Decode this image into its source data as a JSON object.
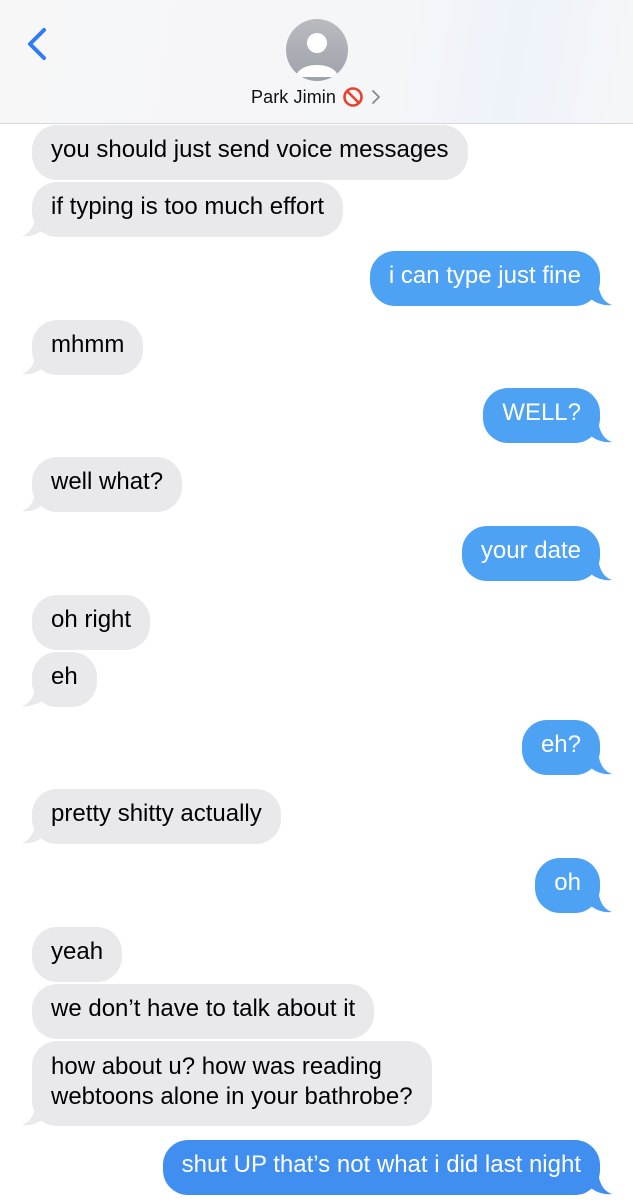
{
  "header": {
    "contact_name": "Park Jimin",
    "back_icon": "chevron-left-icon",
    "avatar_icon": "person-silhouette-icon",
    "status_icon": "blocked-icon",
    "detail_icon": "chevron-right-icon"
  },
  "colors": {
    "sent_bubble": "#4ea2f4",
    "received_bubble": "#e9e9eb",
    "accent": "#2f7cf6",
    "blocked_red": "#e8412d"
  },
  "messages": [
    {
      "side": "received",
      "text": "you should just send voice messages"
    },
    {
      "side": "received",
      "text": "if typing is too much effort"
    },
    {
      "side": "sent",
      "text": "i can type just fine"
    },
    {
      "side": "received",
      "text": "mhmm"
    },
    {
      "side": "sent",
      "text": "WELL?"
    },
    {
      "side": "received",
      "text": "well what?"
    },
    {
      "side": "sent",
      "text": "your date"
    },
    {
      "side": "received",
      "text": "oh right"
    },
    {
      "side": "received",
      "text": "eh"
    },
    {
      "side": "sent",
      "text": "eh?"
    },
    {
      "side": "received",
      "text": "pretty shitty actually"
    },
    {
      "side": "sent",
      "text": "oh"
    },
    {
      "side": "received",
      "text": "yeah"
    },
    {
      "side": "received",
      "text": "we don’t have to talk about it"
    },
    {
      "side": "received",
      "text": "how about u? how was reading\nwebtoons alone in your bathrobe?"
    },
    {
      "side": "sent",
      "text": "shut UP that’s not what i did last night"
    }
  ]
}
